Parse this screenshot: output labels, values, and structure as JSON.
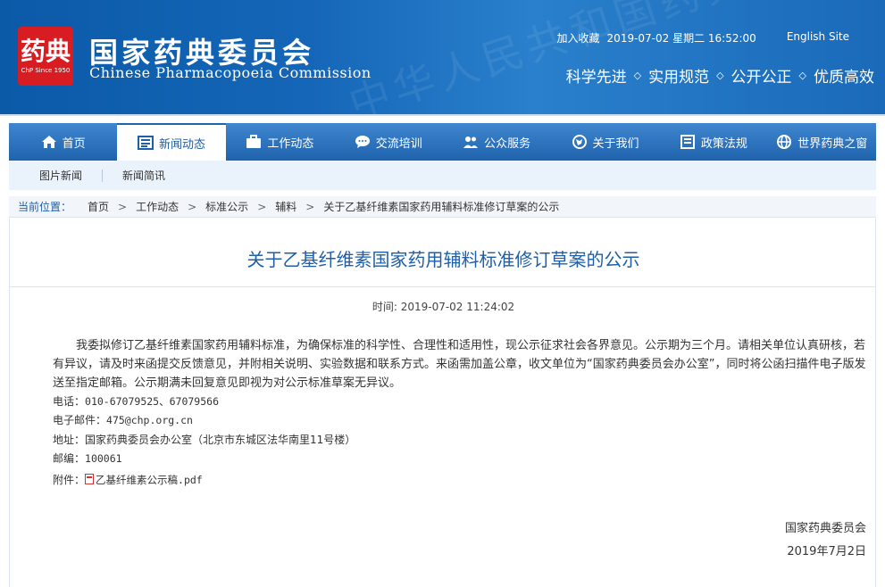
{
  "header": {
    "title_cn": "国家药典委员会",
    "title_en": "Chinese Pharmacopoeia Commission",
    "seal_text": "药典",
    "seal_caption": "ChP Since 1950",
    "watermark": "中华人民共和国药典",
    "bookmark_label": "加入收藏",
    "datetime": "2019-07-02 星期二 16:52:00",
    "english_site_label": "English Site",
    "slogans": [
      "科学先进",
      "实用规范",
      "公开公正",
      "优质高效"
    ],
    "slogan_sep": "◇"
  },
  "nav": {
    "items": [
      {
        "label": "首页",
        "icon": "home-icon"
      },
      {
        "label": "新闻动态",
        "icon": "news-icon",
        "active": true
      },
      {
        "label": "工作动态",
        "icon": "briefcase-icon"
      },
      {
        "label": "交流培训",
        "icon": "chat-icon"
      },
      {
        "label": "公众服务",
        "icon": "users-icon"
      },
      {
        "label": "关于我们",
        "icon": "globe-icon"
      },
      {
        "label": "政策法规",
        "icon": "document-icon"
      },
      {
        "label": "世界药典之窗",
        "icon": "world-icon"
      }
    ],
    "active_color": "#1f5ea8"
  },
  "subnav": {
    "items": [
      "图片新闻",
      "新闻简讯"
    ]
  },
  "breadcrumb": {
    "lead": "当前位置：",
    "items": [
      "首页",
      "工作动态",
      "标准公示",
      "辅料",
      "关于乙基纤维素国家药用辅料标准修订草案的公示"
    ],
    "sep": ">"
  },
  "article": {
    "title": "关于乙基纤维素国家药用辅料标准修订草案的公示",
    "time_label": "时间:",
    "time_value": "2019-07-02 11:24:02",
    "body": "我委拟修订乙基纤维素国家药用辅料标准，为确保标准的科学性、合理性和适用性，现公示征求社会各界意见。公示期为三个月。请相关单位认真研核，若有异议，请及时来函提交反馈意见，并附相关说明、实验数据和联系方式。来函需加盖公章，收文单位为“国家药典委员会办公室”，同时将公函扫描件电子版发送至指定邮箱。公示期满未回复意见即视为对公示标准草案无异议。",
    "phone_label": "电话：",
    "phone_value": "010-67079525、67079566",
    "email_label": "电子邮件：",
    "email_value": "475@chp.org.cn",
    "address_label": "地址：",
    "address_value": "国家药典委员会办公室（北京市东城区法华南里11号楼）",
    "postcode_label": "邮编：",
    "postcode_value": "100061",
    "attachment_label": "附件：",
    "attachment_file": "乙基纤维素公示稿.pdf",
    "signature_org": "国家药典委员会",
    "signature_date": "2019年7月2日"
  },
  "colors": {
    "header_bg": "#1566b8",
    "seal_red": "#d71d22",
    "title_blue": "#1f5ea8"
  }
}
